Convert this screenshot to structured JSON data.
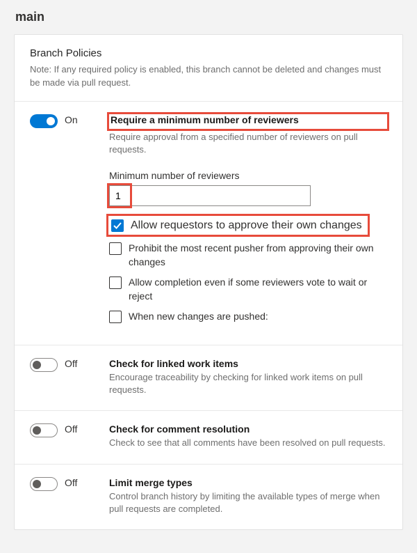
{
  "page": {
    "title": "main"
  },
  "card": {
    "title": "Branch Policies",
    "note": "Note: If any required policy is enabled, this branch cannot be deleted and changes must be made via pull request."
  },
  "policies": {
    "minReviewers": {
      "toggle_state": "On",
      "title": "Require a minimum number of reviewers",
      "desc": "Require approval from a specified number of reviewers on pull requests.",
      "field_label": "Minimum number of reviewers",
      "value": "1",
      "options": {
        "allow_self": "Allow requestors to approve their own changes",
        "prohibit_recent_pusher": "Prohibit the most recent pusher from approving their own changes",
        "allow_completion": "Allow completion even if some reviewers vote to wait or reject",
        "new_changes": "When new changes are pushed:"
      }
    },
    "linkedWorkItems": {
      "toggle_state": "Off",
      "title": "Check for linked work items",
      "desc": "Encourage traceability by checking for linked work items on pull requests."
    },
    "commentResolution": {
      "toggle_state": "Off",
      "title": "Check for comment resolution",
      "desc": "Check to see that all comments have been resolved on pull requests."
    },
    "mergeTypes": {
      "toggle_state": "Off",
      "title": "Limit merge types",
      "desc": "Control branch history by limiting the available types of merge when pull requests are completed."
    }
  }
}
